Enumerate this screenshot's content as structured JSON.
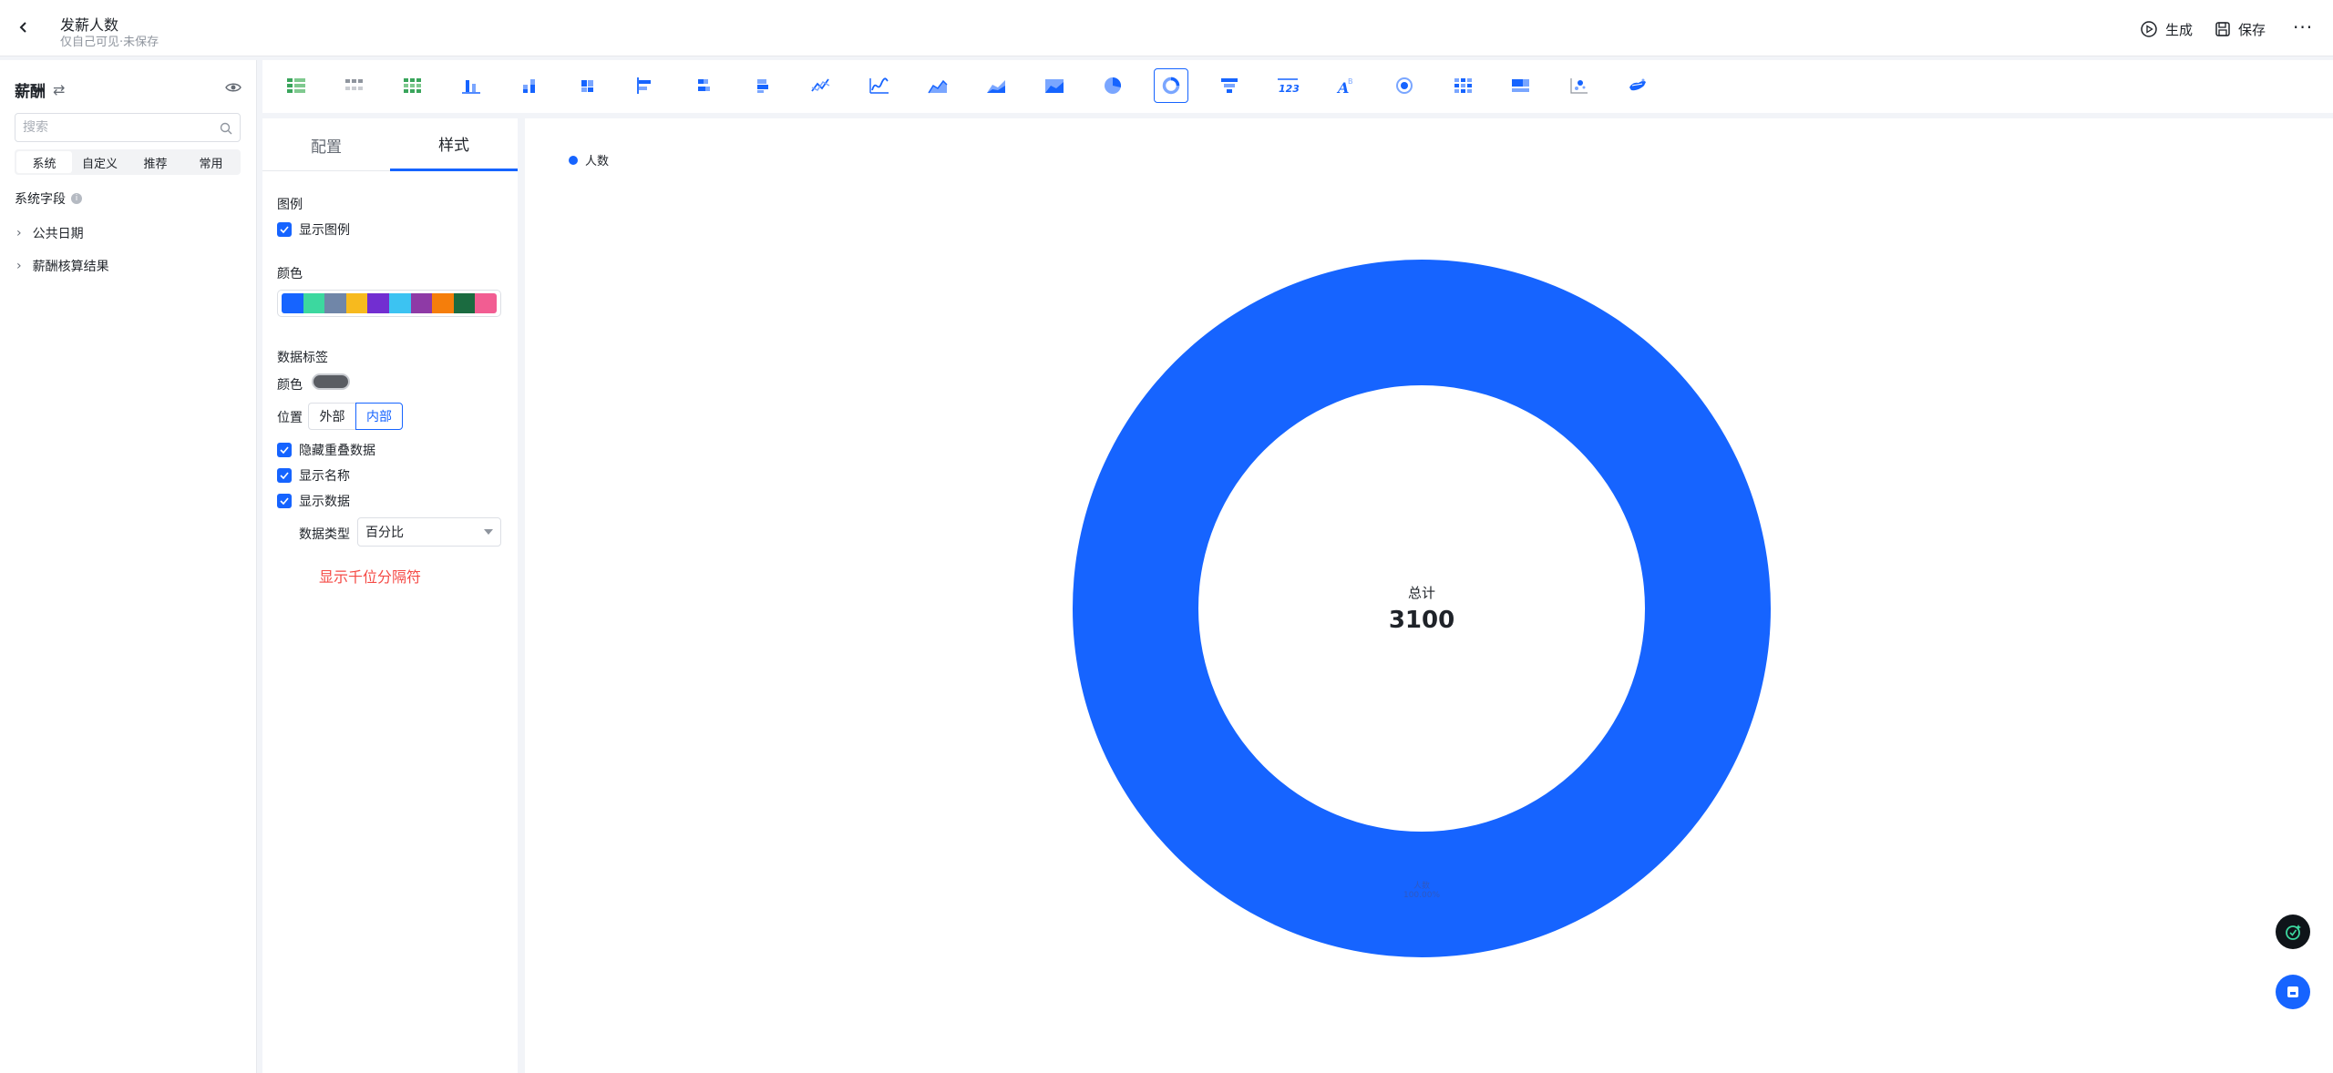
{
  "header": {
    "title": "发薪人数",
    "subtitle": "仅自己可见·未保存",
    "generate_label": "生成",
    "save_label": "保存",
    "more_label": "···"
  },
  "sidebar": {
    "dataset_name": "薪酬",
    "search_placeholder": "搜索",
    "tabs": [
      "系统",
      "自定义",
      "推荐",
      "常用"
    ],
    "active_tab": "系统",
    "section_label": "系统字段",
    "tree_items": [
      "公共日期",
      "薪酬核算结果"
    ]
  },
  "toolbar": {
    "icons": [
      "table-icon",
      "pivot-table-icon",
      "detail-table-icon",
      "column-chart-icon",
      "stacked-column-icon",
      "grouped-column-icon",
      "bar-chart-icon",
      "stacked-bar-icon",
      "grouped-bar-icon",
      "line-chart-icon",
      "smooth-line-icon",
      "area-chart-icon",
      "stacked-area-icon",
      "percent-area-icon",
      "pie-chart-icon",
      "donut-chart-icon",
      "funnel-chart-icon",
      "indicator-card-icon",
      "word-cloud-icon",
      "gauge-icon",
      "heatmap-icon",
      "combo-chart-icon",
      "scatter-chart-icon",
      "map-icon"
    ],
    "active": "donut-chart-icon"
  },
  "config": {
    "tabs": [
      "配置",
      "样式"
    ],
    "active_tab": "样式",
    "legend_section": "图例",
    "show_legend_label": "显示图例",
    "color_section": "颜色",
    "palette": [
      "#1664ff",
      "#3cd89f",
      "#7086a8",
      "#f7ba1e",
      "#722ed1",
      "#3cc3f2",
      "#8e3aa6",
      "#f57e0b",
      "#1b6b40",
      "#f25d92"
    ],
    "data_label_section": "数据标签",
    "label_color_label": "颜色",
    "position_label": "位置",
    "position_options": [
      "外部",
      "内部"
    ],
    "position_selected": "内部",
    "hide_overlap_label": "隐藏重叠数据",
    "show_name_label": "显示名称",
    "show_data_label": "显示数据",
    "data_type_label": "数据类型",
    "data_type_value": "百分比",
    "thousands_separator_label": "显示千位分隔符"
  },
  "chart": {
    "legend_item": "人数",
    "center_title": "总计",
    "center_value": "3100",
    "slice_label_name": "人数",
    "slice_label_value": "100.00%"
  },
  "chart_data": {
    "type": "pie",
    "categories": [
      "人数"
    ],
    "values": [
      3100
    ],
    "colors": [
      "#1664ff"
    ],
    "donut": true,
    "legend_position": "top-left"
  }
}
